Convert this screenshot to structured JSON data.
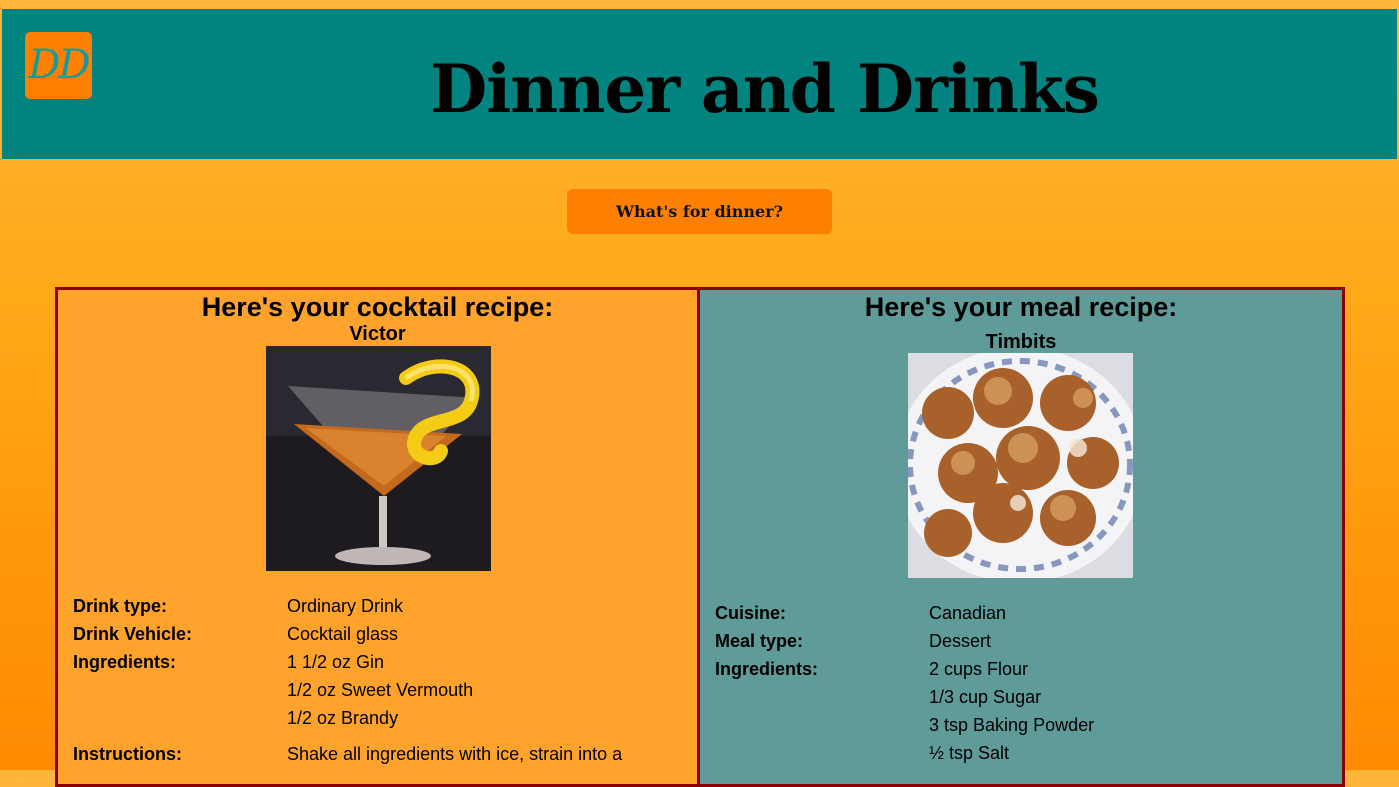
{
  "header": {
    "logo_text": "DD",
    "title": "Dinner and Drinks"
  },
  "actions": {
    "dinner_button": "What's for dinner?"
  },
  "drink": {
    "heading": "Here's your cocktail recipe:",
    "name": "Victor",
    "details": {
      "type_label": "Drink type:",
      "type_value": "Ordinary Drink",
      "vehicle_label": "Drink Vehicle:",
      "vehicle_value": "Cocktail glass",
      "ingredients_label": "Ingredients:",
      "ingredients": [
        "1 1/2 oz Gin",
        "1/2 oz Sweet Vermouth",
        "1/2 oz Brandy"
      ],
      "instructions_label": "Instructions:",
      "instructions": "Shake all ingredients with ice, strain into a"
    }
  },
  "meal": {
    "heading": "Here's your meal recipe:",
    "name": "Timbits",
    "details": {
      "cuisine_label": "Cuisine:",
      "cuisine_value": "Canadian",
      "type_label": "Meal type:",
      "type_value": "Dessert",
      "ingredients_label": "Ingredients:",
      "ingredients": [
        "2 cups Flour",
        "1/3 cup Sugar",
        "3 tsp Baking Powder",
        "½ tsp Salt"
      ]
    }
  },
  "colors": {
    "header_bg": "#018380",
    "accent_orange": "#ff8000",
    "card_border": "#8b0000",
    "drink_card_bg": "#ffa32d",
    "meal_card_bg": "#5f9b98"
  }
}
